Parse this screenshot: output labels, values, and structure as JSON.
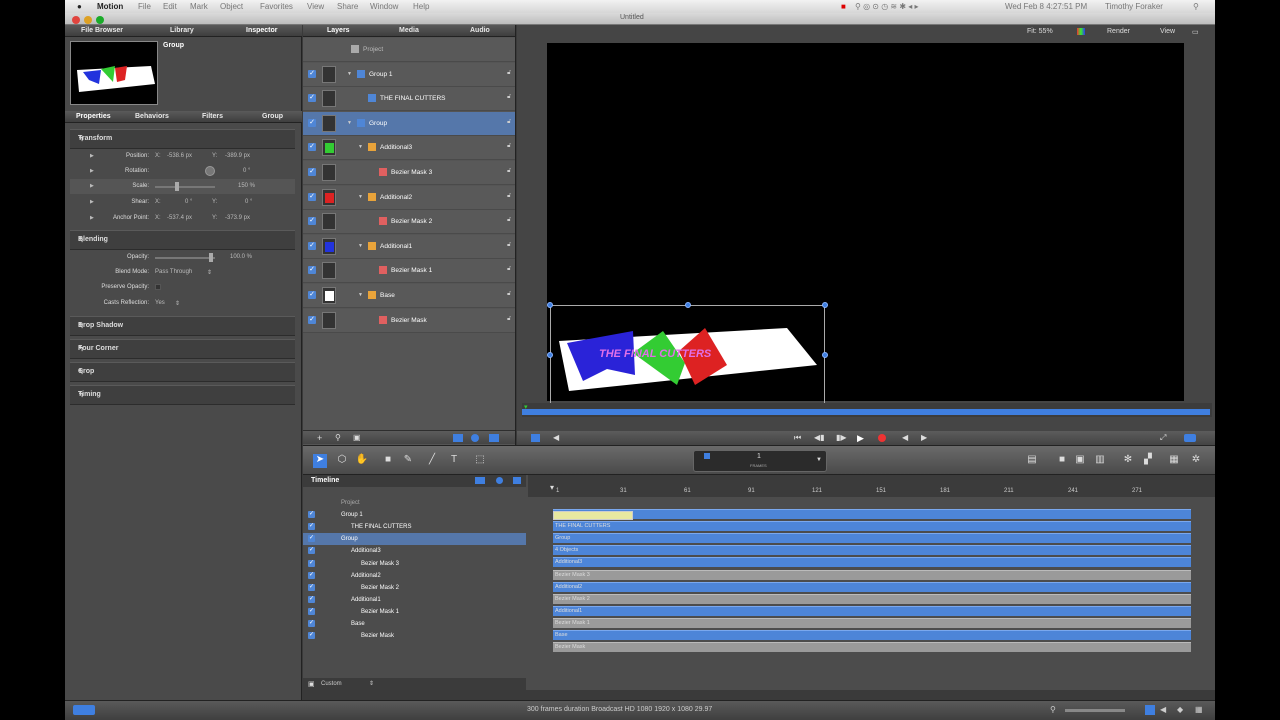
{
  "menu": {
    "app": "Motion",
    "items": [
      "File",
      "Edit",
      "Mark",
      "Object",
      "Favorites",
      "View",
      "Share",
      "Window",
      "Help"
    ],
    "clock": "Wed Feb 8  4:27:51 PM",
    "user": "Timothy Foraker"
  },
  "window": {
    "title": "Untitled"
  },
  "left_tabs": [
    "File Browser",
    "Library",
    "Inspector"
  ],
  "preview": {
    "label": "Group"
  },
  "inspector_tabs": [
    "Properties",
    "Behaviors",
    "Filters",
    "Group"
  ],
  "transform": {
    "title": "Transform",
    "rows": [
      {
        "label": "Position:",
        "x_label": "X:",
        "x": "-538.6 px",
        "y_label": "Y:",
        "y": "-389.9 px"
      },
      {
        "label": "Rotation:",
        "value": "0 °"
      },
      {
        "label": "Scale:",
        "value": "150 %"
      },
      {
        "label": "Shear:",
        "x_label": "X:",
        "x": "0 °",
        "y_label": "Y:",
        "y": "0 °"
      },
      {
        "label": "Anchor Point:",
        "x_label": "X:",
        "x": "-537.4 px",
        "y_label": "Y:",
        "y": "-373.9 px"
      }
    ]
  },
  "blending": {
    "title": "Blending",
    "opacity_label": "Opacity:",
    "opacity": "100.0 %",
    "blend_label": "Blend Mode:",
    "blend": "Pass Through",
    "preserve_label": "Preserve Opacity:",
    "casts_label": "Casts Reflection:",
    "casts": "Yes"
  },
  "sections": [
    "Drop Shadow",
    "Four Corner",
    "Crop",
    "Timing"
  ],
  "layers_tabs": [
    "Layers",
    "Media",
    "Audio"
  ],
  "layers": [
    {
      "name": "Project",
      "indent": 0,
      "type": "project"
    },
    {
      "name": "Group 1",
      "indent": 1,
      "type": "group"
    },
    {
      "name": "THE FINAL CUTTERS",
      "indent": 2,
      "type": "text"
    },
    {
      "name": "Group",
      "indent": 1,
      "type": "group",
      "selected": true
    },
    {
      "name": "Additional3",
      "indent": 2,
      "type": "shape",
      "color": "#33cc33"
    },
    {
      "name": "Bezier Mask 3",
      "indent": 3,
      "type": "mask"
    },
    {
      "name": "Additional2",
      "indent": 2,
      "type": "shape",
      "color": "#dd2222"
    },
    {
      "name": "Bezier Mask 2",
      "indent": 3,
      "type": "mask"
    },
    {
      "name": "Additional1",
      "indent": 2,
      "type": "shape",
      "color": "#2233dd"
    },
    {
      "name": "Bezier Mask 1",
      "indent": 3,
      "type": "mask"
    },
    {
      "name": "Base",
      "indent": 2,
      "type": "shape",
      "color": "#ffffff"
    },
    {
      "name": "Bezier Mask",
      "indent": 3,
      "type": "mask"
    }
  ],
  "canvas_top": {
    "fit": "Fit: 55%",
    "render": "Render",
    "view": "View"
  },
  "canvas_text": "THE FINAL CUTTERS",
  "timeline": {
    "title": "Timeline",
    "ticks": [
      "1",
      "31",
      "61",
      "91",
      "121",
      "151",
      "181",
      "211",
      "241",
      "271"
    ],
    "rows": [
      "Project",
      "Group 1",
      "THE FINAL CUTTERS",
      "Group",
      "Additional3",
      "Bezier Mask 3",
      "Additional2",
      "Bezier Mask 2",
      "Additional1",
      "Bezier Mask 1",
      "Base",
      "Bezier Mask"
    ],
    "bars": [
      "Group 1",
      "THE FINAL CUTTERS",
      "Group",
      "4 Objects",
      "Additional3",
      "Bezier Mask 3",
      "Additional2",
      "Bezier Mask 2",
      "Additional1",
      "Bezier Mask 1",
      "Base",
      "Bezier Mask"
    ],
    "custom": "Custom",
    "frames": "FRAMES",
    "frame_value": "1"
  },
  "status": {
    "text": "300 frames duration Broadcast HD 1080 1920 x 1080 29.97"
  },
  "colors": {
    "accent": "#4d85d8",
    "selection": "#5577aa"
  }
}
